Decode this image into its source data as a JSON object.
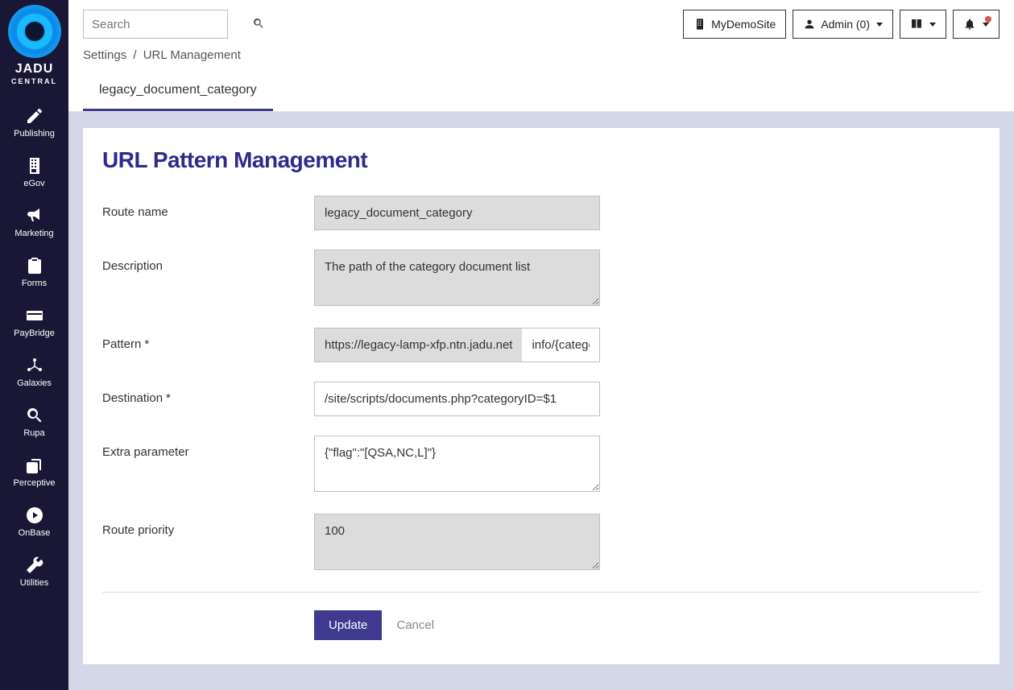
{
  "brand": {
    "name": "JADU",
    "sub": "CENTRAL"
  },
  "sidebar": {
    "items": [
      {
        "label": "Publishing",
        "icon": "pencil"
      },
      {
        "label": "eGov",
        "icon": "building"
      },
      {
        "label": "Marketing",
        "icon": "bullhorn"
      },
      {
        "label": "Forms",
        "icon": "clipboard"
      },
      {
        "label": "PayBridge",
        "icon": "card"
      },
      {
        "label": "Galaxies",
        "icon": "network"
      },
      {
        "label": "Rupa",
        "icon": "search"
      },
      {
        "label": "Perceptive",
        "icon": "copy"
      },
      {
        "label": "OnBase",
        "icon": "play-circle"
      },
      {
        "label": "Utilities",
        "icon": "wrench"
      }
    ]
  },
  "header": {
    "search_placeholder": "Search",
    "site_button": "MyDemoSite",
    "admin_button": "Admin (0)"
  },
  "breadcrumb": {
    "a": "Settings",
    "b": "URL Management"
  },
  "tabs": {
    "active": "legacy_document_category"
  },
  "page": {
    "title": "URL Pattern Management",
    "labels": {
      "route_name": "Route name",
      "description": "Description",
      "pattern": "Pattern",
      "destination": "Destination",
      "extra_parameter": "Extra parameter",
      "route_priority": "Route priority"
    },
    "values": {
      "route_name": "legacy_document_category",
      "description": "The path of the category document list",
      "pattern_prefix": "https://legacy-lamp-xfp.ntn.jadu.net",
      "pattern_value": "info/{categorySlug}",
      "destination": "/site/scripts/documents.php?categoryID=$1",
      "extra_parameter": "{\"flag\":\"[QSA,NC,L]\"}",
      "route_priority": "100"
    },
    "actions": {
      "update": "Update",
      "cancel": "Cancel"
    }
  }
}
